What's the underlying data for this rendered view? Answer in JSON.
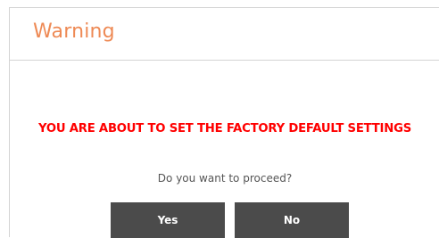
{
  "dialog": {
    "title": "Warning",
    "warning_message": "YOU ARE ABOUT TO SET THE FACTORY DEFAULT SETTINGS",
    "question": "Do you want to proceed?",
    "buttons": {
      "yes_label": "Yes",
      "no_label": "No"
    }
  },
  "colors": {
    "title": "#ee8a55",
    "warning": "#ff0000",
    "button_bg": "#4b4b4b",
    "button_text": "#ffffff",
    "divider": "#d4d4d4"
  }
}
